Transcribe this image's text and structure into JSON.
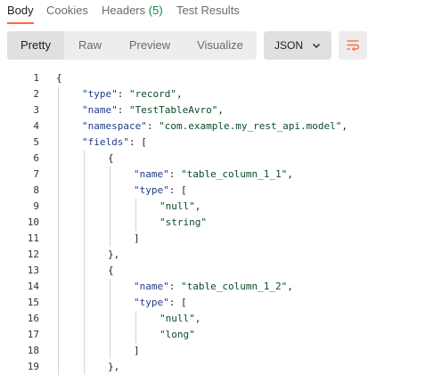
{
  "tabs": [
    {
      "label": "Body",
      "active": true
    },
    {
      "label": "Cookies"
    },
    {
      "label": "Headers",
      "count": "(5)"
    },
    {
      "label": "Test Results"
    }
  ],
  "view_modes": [
    "Pretty",
    "Raw",
    "Preview",
    "Visualize"
  ],
  "active_view": "Pretty",
  "language": "JSON",
  "icons": {
    "dropdown": "chevron-down-icon",
    "wrap": "wrap-lines-icon"
  },
  "colors": {
    "accent": "#ff6c37",
    "key": "#1f3c8a",
    "string": "#0a4d24",
    "count": "#0b8a3e"
  },
  "code_lines": [
    {
      "n": "1",
      "indent": 0,
      "parts": [
        [
          "p",
          "{"
        ]
      ]
    },
    {
      "n": "2",
      "indent": 1,
      "parts": [
        [
          "k",
          "\"type\""
        ],
        [
          "p",
          ": "
        ],
        [
          "s",
          "\"record\""
        ],
        [
          "p",
          ","
        ]
      ]
    },
    {
      "n": "3",
      "indent": 1,
      "parts": [
        [
          "k",
          "\"name\""
        ],
        [
          "p",
          ": "
        ],
        [
          "s",
          "\"TestTableAvro\""
        ],
        [
          "p",
          ","
        ]
      ]
    },
    {
      "n": "4",
      "indent": 1,
      "parts": [
        [
          "k",
          "\"namespace\""
        ],
        [
          "p",
          ": "
        ],
        [
          "s",
          "\"com.example.my_rest_api.model\""
        ],
        [
          "p",
          ","
        ]
      ]
    },
    {
      "n": "5",
      "indent": 1,
      "parts": [
        [
          "k",
          "\"fields\""
        ],
        [
          "p",
          ": ["
        ]
      ]
    },
    {
      "n": "6",
      "indent": 2,
      "parts": [
        [
          "p",
          "{"
        ]
      ]
    },
    {
      "n": "7",
      "indent": 3,
      "parts": [
        [
          "k",
          "\"name\""
        ],
        [
          "p",
          ": "
        ],
        [
          "s",
          "\"table_column_1_1\""
        ],
        [
          "p",
          ","
        ]
      ]
    },
    {
      "n": "8",
      "indent": 3,
      "parts": [
        [
          "k",
          "\"type\""
        ],
        [
          "p",
          ": ["
        ]
      ]
    },
    {
      "n": "9",
      "indent": 4,
      "parts": [
        [
          "s",
          "\"null\""
        ],
        [
          "p",
          ","
        ]
      ]
    },
    {
      "n": "10",
      "indent": 4,
      "parts": [
        [
          "s",
          "\"string\""
        ]
      ]
    },
    {
      "n": "11",
      "indent": 3,
      "parts": [
        [
          "p",
          "]"
        ]
      ]
    },
    {
      "n": "12",
      "indent": 2,
      "parts": [
        [
          "p",
          "},"
        ]
      ]
    },
    {
      "n": "13",
      "indent": 2,
      "parts": [
        [
          "p",
          "{"
        ]
      ]
    },
    {
      "n": "14",
      "indent": 3,
      "parts": [
        [
          "k",
          "\"name\""
        ],
        [
          "p",
          ": "
        ],
        [
          "s",
          "\"table_column_1_2\""
        ],
        [
          "p",
          ","
        ]
      ]
    },
    {
      "n": "15",
      "indent": 3,
      "parts": [
        [
          "k",
          "\"type\""
        ],
        [
          "p",
          ": ["
        ]
      ]
    },
    {
      "n": "16",
      "indent": 4,
      "parts": [
        [
          "s",
          "\"null\""
        ],
        [
          "p",
          ","
        ]
      ]
    },
    {
      "n": "17",
      "indent": 4,
      "parts": [
        [
          "s",
          "\"long\""
        ]
      ]
    },
    {
      "n": "18",
      "indent": 3,
      "parts": [
        [
          "p",
          "]"
        ]
      ]
    },
    {
      "n": "19",
      "indent": 2,
      "parts": [
        [
          "p",
          "},"
        ]
      ]
    }
  ]
}
